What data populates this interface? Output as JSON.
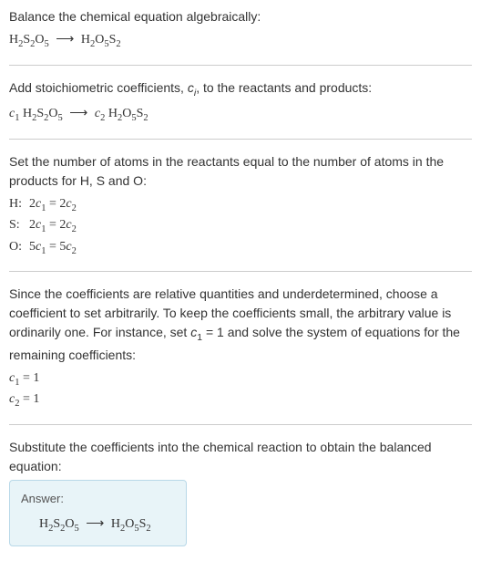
{
  "section1": {
    "instruction": "Balance the chemical equation algebraically:",
    "formula_left": "H",
    "formula_left_s1": "2",
    "formula_left_m": "S",
    "formula_left_s2": "2",
    "formula_left_o": "O",
    "formula_left_s3": "5",
    "arrow": "⟶",
    "formula_right": "H",
    "formula_right_s1": "2",
    "formula_right_o": "O",
    "formula_right_s2": "5",
    "formula_right_m": "S",
    "formula_right_s3": "2"
  },
  "section2": {
    "instruction_part1": "Add stoichiometric coefficients, ",
    "instruction_ci": "c",
    "instruction_ci_sub": "i",
    "instruction_part2": ", to the reactants and products:",
    "c1": "c",
    "c1_sub": "1",
    "sp": " ",
    "f1_h": "H",
    "f1_s1": "2",
    "f1_s": "S",
    "f1_s2": "2",
    "f1_o": "O",
    "f1_s3": "5",
    "arrow": "⟶",
    "c2": "c",
    "c2_sub": "2",
    "f2_h": "H",
    "f2_s1": "2",
    "f2_o": "O",
    "f2_s2": "5",
    "f2_s": "S",
    "f2_s3": "2"
  },
  "section3": {
    "instruction": "Set the number of atoms in the reactants equal to the number of atoms in the products for H, S and O:",
    "rows": [
      {
        "label": "H:",
        "lhs_num": "2",
        "lhs_c": "c",
        "lhs_sub": "1",
        "eq": " = ",
        "rhs_num": "2",
        "rhs_c": "c",
        "rhs_sub": "2"
      },
      {
        "label": "S:",
        "lhs_num": "2",
        "lhs_c": "c",
        "lhs_sub": "1",
        "eq": " = ",
        "rhs_num": "2",
        "rhs_c": "c",
        "rhs_sub": "2"
      },
      {
        "label": "O:",
        "lhs_num": "5",
        "lhs_c": "c",
        "lhs_sub": "1",
        "eq": " = ",
        "rhs_num": "5",
        "rhs_c": "c",
        "rhs_sub": "2"
      }
    ]
  },
  "section4": {
    "instruction_part1": "Since the coefficients are relative quantities and underdetermined, choose a coefficient to set arbitrarily. To keep the coefficients small, the arbitrary value is ordinarily one. For instance, set ",
    "c1": "c",
    "c1_sub": "1",
    "eq1": " = 1",
    "instruction_part2": " and solve the system of equations for the remaining coefficients:",
    "line1_c": "c",
    "line1_sub": "1",
    "line1_val": " = 1",
    "line2_c": "c",
    "line2_sub": "2",
    "line2_val": " = 1"
  },
  "section5": {
    "instruction": "Substitute the coefficients into the chemical reaction to obtain the balanced equation:",
    "answer_label": "Answer:",
    "f1_h": "H",
    "f1_s1": "2",
    "f1_s": "S",
    "f1_s2": "2",
    "f1_o": "O",
    "f1_s3": "5",
    "arrow": "⟶",
    "f2_h": "H",
    "f2_s1": "2",
    "f2_o": "O",
    "f2_s2": "5",
    "f2_s": "S",
    "f2_s3": "2"
  }
}
